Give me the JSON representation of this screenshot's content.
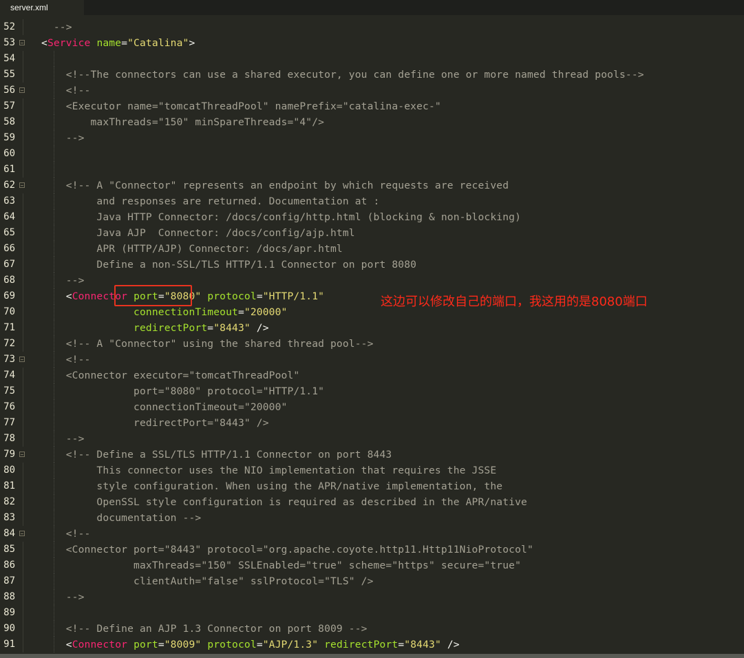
{
  "tab": {
    "label": "server.xml"
  },
  "annotation": {
    "text": "这边可以修改自己的端口，我这用的是8080端口"
  },
  "colors": {
    "background": "#272822",
    "comment": "#a5a294",
    "tag": "#f92672",
    "attribute": "#a6e22e",
    "string": "#e6db74",
    "annotation": "#ff2a1a",
    "highlight_box": "#e8331f"
  },
  "lines": [
    {
      "n": "52",
      "fold": false,
      "tokens": [
        [
          "comment",
          "  -->"
        ]
      ]
    },
    {
      "n": "53",
      "fold": true,
      "tokens": [
        [
          "punc",
          "<"
        ],
        [
          "tag",
          "Service"
        ],
        [
          "punc",
          " "
        ],
        [
          "attr",
          "name"
        ],
        [
          "punc",
          "="
        ],
        [
          "str",
          "\"Catalina\""
        ],
        [
          "punc",
          ">"
        ]
      ]
    },
    {
      "n": "54",
      "fold": false,
      "tokens": []
    },
    {
      "n": "55",
      "fold": false,
      "tokens": [
        [
          "comment",
          "    <!--The connectors can use a shared executor, you can define one or more named thread pools-->"
        ]
      ]
    },
    {
      "n": "56",
      "fold": true,
      "tokens": [
        [
          "comment",
          "    <!--"
        ]
      ]
    },
    {
      "n": "57",
      "fold": false,
      "tokens": [
        [
          "comment",
          "    <Executor name=\"tomcatThreadPool\" namePrefix=\"catalina-exec-\""
        ]
      ]
    },
    {
      "n": "58",
      "fold": false,
      "tokens": [
        [
          "comment",
          "        maxThreads=\"150\" minSpareThreads=\"4\"/>"
        ]
      ]
    },
    {
      "n": "59",
      "fold": false,
      "tokens": [
        [
          "comment",
          "    -->"
        ]
      ]
    },
    {
      "n": "60",
      "fold": false,
      "tokens": []
    },
    {
      "n": "61",
      "fold": false,
      "tokens": []
    },
    {
      "n": "62",
      "fold": true,
      "tokens": [
        [
          "comment",
          "    <!-- A \"Connector\" represents an endpoint by which requests are received"
        ]
      ]
    },
    {
      "n": "63",
      "fold": false,
      "tokens": [
        [
          "comment",
          "         and responses are returned. Documentation at :"
        ]
      ]
    },
    {
      "n": "64",
      "fold": false,
      "tokens": [
        [
          "comment",
          "         Java HTTP Connector: /docs/config/http.html (blocking & non-blocking)"
        ]
      ]
    },
    {
      "n": "65",
      "fold": false,
      "tokens": [
        [
          "comment",
          "         Java AJP  Connector: /docs/config/ajp.html"
        ]
      ]
    },
    {
      "n": "66",
      "fold": false,
      "tokens": [
        [
          "comment",
          "         APR (HTTP/AJP) Connector: /docs/apr.html"
        ]
      ]
    },
    {
      "n": "67",
      "fold": false,
      "tokens": [
        [
          "comment",
          "         Define a non-SSL/TLS HTTP/1.1 Connector on port 8080"
        ]
      ]
    },
    {
      "n": "68",
      "fold": false,
      "tokens": [
        [
          "comment",
          "    -->"
        ]
      ]
    },
    {
      "n": "69",
      "fold": false,
      "tokens": [
        [
          "punc",
          "    <"
        ],
        [
          "tag",
          "Connector"
        ],
        [
          "punc",
          " "
        ],
        [
          "attr",
          "port"
        ],
        [
          "punc",
          "="
        ],
        [
          "str",
          "\"8080\""
        ],
        [
          "punc",
          " "
        ],
        [
          "attr",
          "protocol"
        ],
        [
          "punc",
          "="
        ],
        [
          "str",
          "\"HTTP/1.1\""
        ]
      ]
    },
    {
      "n": "70",
      "fold": false,
      "tokens": [
        [
          "punc",
          "               "
        ],
        [
          "attr",
          "connectionTimeout"
        ],
        [
          "punc",
          "="
        ],
        [
          "str",
          "\"20000\""
        ]
      ]
    },
    {
      "n": "71",
      "fold": false,
      "tokens": [
        [
          "punc",
          "               "
        ],
        [
          "attr",
          "redirectPort"
        ],
        [
          "punc",
          "="
        ],
        [
          "str",
          "\"8443\""
        ],
        [
          "punc",
          " />"
        ]
      ]
    },
    {
      "n": "72",
      "fold": false,
      "tokens": [
        [
          "comment",
          "    <!-- A \"Connector\" using the shared thread pool-->"
        ]
      ]
    },
    {
      "n": "73",
      "fold": true,
      "tokens": [
        [
          "comment",
          "    <!--"
        ]
      ]
    },
    {
      "n": "74",
      "fold": false,
      "tokens": [
        [
          "comment",
          "    <Connector executor=\"tomcatThreadPool\""
        ]
      ]
    },
    {
      "n": "75",
      "fold": false,
      "tokens": [
        [
          "comment",
          "               port=\"8080\" protocol=\"HTTP/1.1\""
        ]
      ]
    },
    {
      "n": "76",
      "fold": false,
      "tokens": [
        [
          "comment",
          "               connectionTimeout=\"20000\""
        ]
      ]
    },
    {
      "n": "77",
      "fold": false,
      "tokens": [
        [
          "comment",
          "               redirectPort=\"8443\" />"
        ]
      ]
    },
    {
      "n": "78",
      "fold": false,
      "tokens": [
        [
          "comment",
          "    -->"
        ]
      ]
    },
    {
      "n": "79",
      "fold": true,
      "tokens": [
        [
          "comment",
          "    <!-- Define a SSL/TLS HTTP/1.1 Connector on port 8443"
        ]
      ]
    },
    {
      "n": "80",
      "fold": false,
      "tokens": [
        [
          "comment",
          "         This connector uses the NIO implementation that requires the JSSE"
        ]
      ]
    },
    {
      "n": "81",
      "fold": false,
      "tokens": [
        [
          "comment",
          "         style configuration. When using the APR/native implementation, the"
        ]
      ]
    },
    {
      "n": "82",
      "fold": false,
      "tokens": [
        [
          "comment",
          "         OpenSSL style configuration is required as described in the APR/native"
        ]
      ]
    },
    {
      "n": "83",
      "fold": false,
      "tokens": [
        [
          "comment",
          "         documentation -->"
        ]
      ]
    },
    {
      "n": "84",
      "fold": true,
      "tokens": [
        [
          "comment",
          "    <!--"
        ]
      ]
    },
    {
      "n": "85",
      "fold": false,
      "tokens": [
        [
          "comment",
          "    <Connector port=\"8443\" protocol=\"org.apache.coyote.http11.Http11NioProtocol\""
        ]
      ]
    },
    {
      "n": "86",
      "fold": false,
      "tokens": [
        [
          "comment",
          "               maxThreads=\"150\" SSLEnabled=\"true\" scheme=\"https\" secure=\"true\""
        ]
      ]
    },
    {
      "n": "87",
      "fold": false,
      "tokens": [
        [
          "comment",
          "               clientAuth=\"false\" sslProtocol=\"TLS\" />"
        ]
      ]
    },
    {
      "n": "88",
      "fold": false,
      "tokens": [
        [
          "comment",
          "    -->"
        ]
      ]
    },
    {
      "n": "89",
      "fold": false,
      "tokens": []
    },
    {
      "n": "90",
      "fold": false,
      "tokens": [
        [
          "comment",
          "    <!-- Define an AJP 1.3 Connector on port 8009 -->"
        ]
      ]
    },
    {
      "n": "91",
      "fold": false,
      "tokens": [
        [
          "punc",
          "    <"
        ],
        [
          "tag",
          "Connector"
        ],
        [
          "punc",
          " "
        ],
        [
          "attr",
          "port"
        ],
        [
          "punc",
          "="
        ],
        [
          "str",
          "\"8009\""
        ],
        [
          "punc",
          " "
        ],
        [
          "attr",
          "protocol"
        ],
        [
          "punc",
          "="
        ],
        [
          "str",
          "\"AJP/1.3\""
        ],
        [
          "punc",
          " "
        ],
        [
          "attr",
          "redirectPort"
        ],
        [
          "punc",
          "="
        ],
        [
          "str",
          "\"8443\""
        ],
        [
          "punc",
          " />"
        ]
      ]
    }
  ]
}
